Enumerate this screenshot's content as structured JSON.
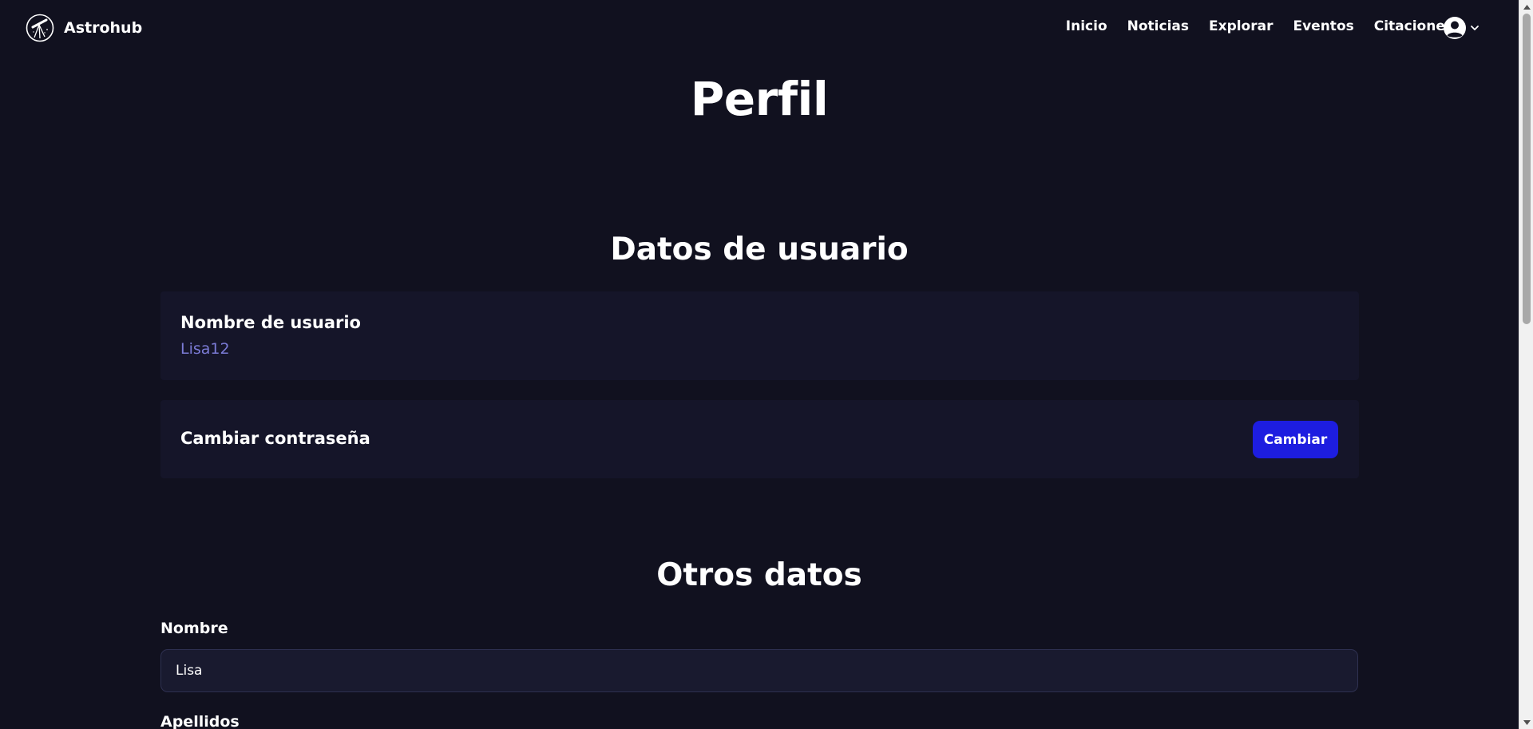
{
  "navbar": {
    "brand_name": "Astrohub",
    "links": [
      "Inicio",
      "Noticias",
      "Explorar",
      "Eventos",
      "Citaciones"
    ]
  },
  "page": {
    "title": "Perfil"
  },
  "user_data": {
    "section_title": "Datos de usuario",
    "username_label": "Nombre de usuario",
    "username_value": "Lisa12",
    "password_label": "Cambiar contraseña",
    "change_button_label": "Cambiar"
  },
  "other_data": {
    "section_title": "Otros datos",
    "nombre_label": "Nombre",
    "nombre_value": "Lisa",
    "apellidos_label": "Apellidos"
  },
  "icons": {
    "logo": "telescope-logo-icon",
    "user": "user-circle-icon",
    "chevron": "chevron-down-icon"
  },
  "colors": {
    "background": "#11111f",
    "card": "#151529",
    "accent_button": "#1d1de0",
    "username_text": "#7b7bd6",
    "input_bg": "#191a2f"
  }
}
